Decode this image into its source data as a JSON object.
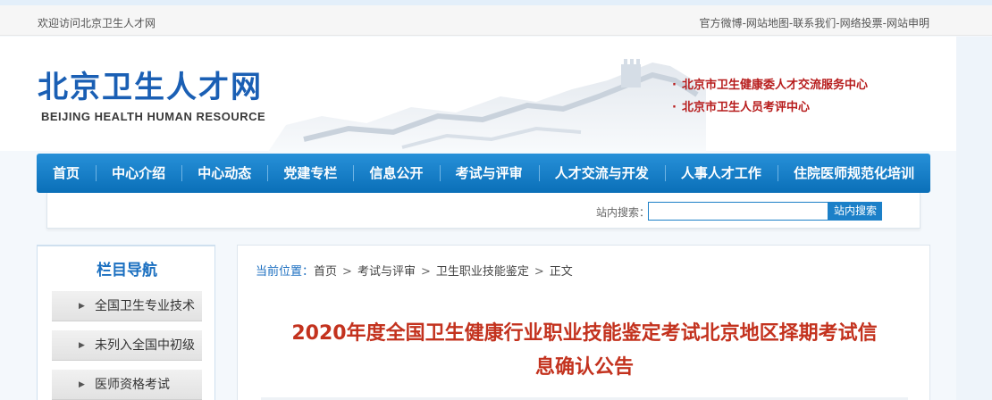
{
  "topbar": {
    "welcome": "欢迎访问北京卫生人才网",
    "links": [
      "官方微博",
      "网站地图",
      "联系我们",
      "网络投票",
      "网站申明"
    ],
    "separator": "-"
  },
  "logo": {
    "cn": "北京卫生人才网",
    "en": "BEIJING HEALTH HUMAN RESOURCE"
  },
  "org_links": [
    {
      "bullet": "·",
      "label": "北京市卫生健康委人才交流服务中心"
    },
    {
      "bullet": "·",
      "label": "北京市卫生人员考评中心"
    }
  ],
  "nav": {
    "items": [
      "首页",
      "中心介绍",
      "中心动态",
      "党建专栏",
      "信息公开",
      "考试与评审",
      "人才交流与开发",
      "人事人才工作",
      "住院医师规范化培训"
    ]
  },
  "search": {
    "label": "站内搜索：",
    "value": "",
    "placeholder": "",
    "button": "站内搜索"
  },
  "sidebar": {
    "title": "栏目导航",
    "items": [
      "全国卫生专业技术",
      "未列入全国中初级",
      "医师资格考试"
    ]
  },
  "breadcrumb": {
    "current_label": "当前位置：",
    "crumbs": [
      "首页",
      "考试与评审",
      "卫生职业技能鉴定",
      "正文"
    ],
    "separator": ">"
  },
  "article": {
    "title_line1": "2020年度全国卫生健康行业职业技能鉴定考试北京地区择期考试信",
    "title_line2": "息确认公告"
  },
  "colors": {
    "nav_blue": "#0a6fb8",
    "logo_blue": "#1a5fb4",
    "org_red": "#b71c1c",
    "title_red": "#c3321e"
  }
}
